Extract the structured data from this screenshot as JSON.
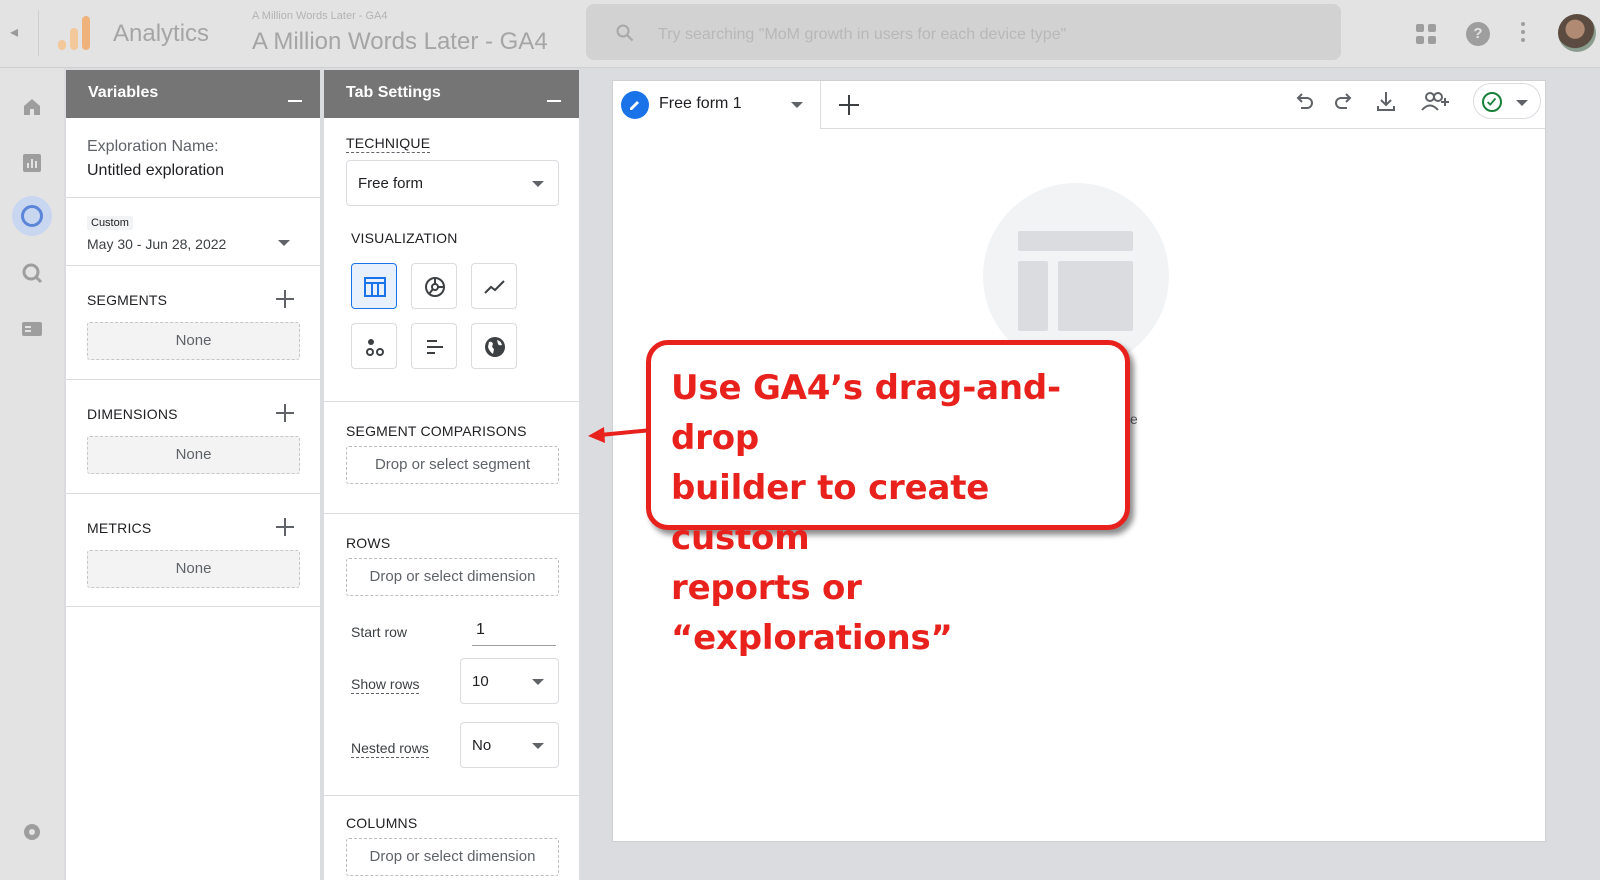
{
  "topbar": {
    "product": "Analytics",
    "account_small": "A Million Words Later - GA4",
    "account_big": "A Million Words Later - GA4",
    "search_placeholder": "Try searching \"MoM growth in users for each device type\""
  },
  "variables_panel": {
    "title": "Variables",
    "exploration_name_label": "Exploration Name:",
    "exploration_name_value": "Untitled exploration",
    "date_badge": "Custom",
    "date_range": "May 30 - Jun 28, 2022",
    "segments_label": "SEGMENTS",
    "segments_value": "None",
    "dimensions_label": "DIMENSIONS",
    "dimensions_value": "None",
    "metrics_label": "METRICS",
    "metrics_value": "None"
  },
  "tab_settings": {
    "title": "Tab Settings",
    "technique_label": "TECHNIQUE",
    "technique_value": "Free form",
    "visualization_label": "VISUALIZATION",
    "visualizations": [
      "table-icon",
      "donut-icon",
      "line-chart-icon",
      "scatter-icon",
      "bar-chart-icon",
      "globe-icon"
    ],
    "segment_comparisons_label": "SEGMENT COMPARISONS",
    "segment_drop": "Drop or select segment",
    "rows_label": "ROWS",
    "rows_drop": "Drop or select dimension",
    "start_row_label": "Start row",
    "start_row_value": "1",
    "show_rows_label": "Show rows",
    "show_rows_value": "10",
    "nested_rows_label": "Nested rows",
    "nested_rows_value": "No",
    "columns_label": "COLUMNS",
    "columns_drop": "Drop or select dimension"
  },
  "canvas": {
    "tab_name": "Free form 1",
    "hint_fragment": "e"
  },
  "callout": {
    "line1": "Use GA4’s drag-and-drop",
    "line2": "builder to create custom",
    "line3": "reports or “explorations”"
  },
  "colors": {
    "accent": "#1a73e8",
    "callout_red": "#e8211c",
    "panel_header": "#757575",
    "success": "#188038"
  }
}
